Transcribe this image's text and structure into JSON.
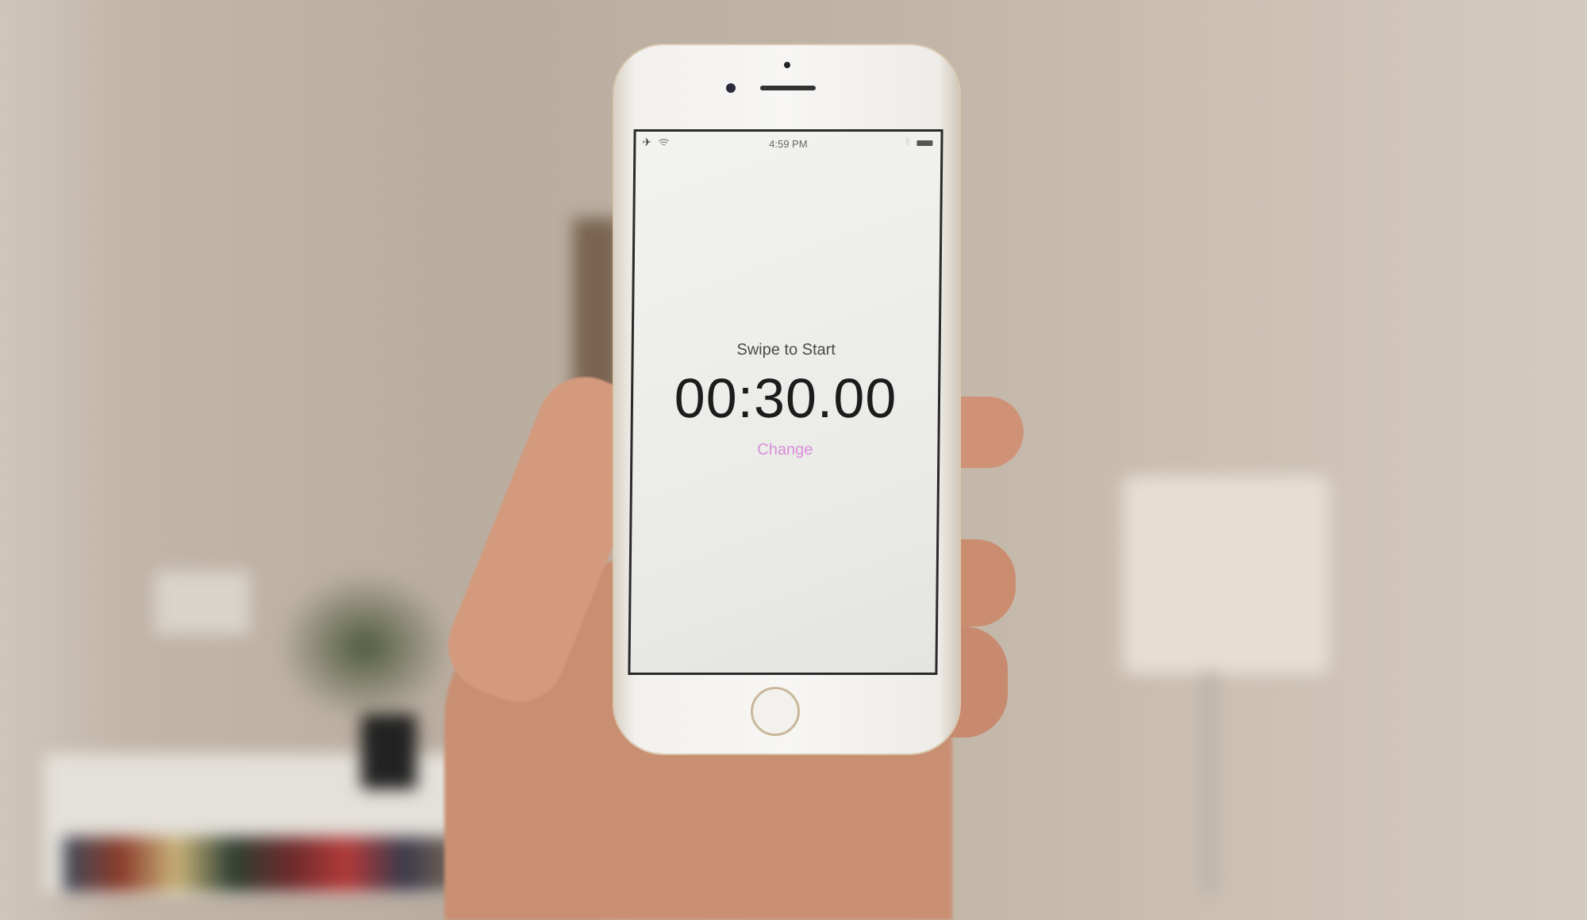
{
  "status_bar": {
    "time": "4:59 PM",
    "icons": [
      "airplane-icon",
      "wifi-icon",
      "bluetooth-icon",
      "battery-icon"
    ]
  },
  "timer": {
    "hint": "Swipe to Start",
    "value": "00:30.00",
    "change_label": "Change"
  },
  "colors": {
    "accent": "#d98fd8",
    "text": "#1c1c1c"
  }
}
